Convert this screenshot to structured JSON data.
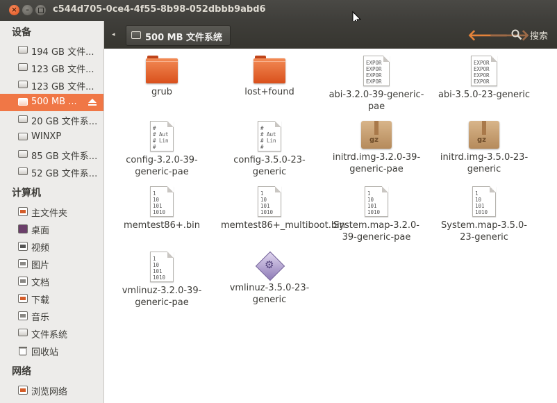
{
  "window": {
    "title": "c544d705-0ce4-4f55-8b98-052dbbb9abd6"
  },
  "sidebar": {
    "devices": {
      "heading": "设备",
      "items": [
        {
          "label": "194 GB 文件...",
          "selected": false
        },
        {
          "label": "123 GB 文件...",
          "selected": false
        },
        {
          "label": "123 GB 文件...",
          "selected": false
        },
        {
          "label": "500 MB ...",
          "selected": true
        },
        {
          "label": "20 GB 文件系...",
          "selected": false
        },
        {
          "label": "WINXP",
          "selected": false
        },
        {
          "label": "85 GB 文件系...",
          "selected": false
        },
        {
          "label": "52 GB 文件系...",
          "selected": false
        }
      ]
    },
    "computer": {
      "heading": "计算机",
      "items": [
        {
          "label": "主文件夹",
          "icon": "home-folder-icon"
        },
        {
          "label": "桌面",
          "icon": "desktop-icon"
        },
        {
          "label": "视频",
          "icon": "videos-icon"
        },
        {
          "label": "图片",
          "icon": "pictures-icon"
        },
        {
          "label": "文档",
          "icon": "documents-icon"
        },
        {
          "label": "下载",
          "icon": "downloads-icon"
        },
        {
          "label": "音乐",
          "icon": "music-icon"
        },
        {
          "label": "文件系统",
          "icon": "filesystem-icon"
        },
        {
          "label": "回收站",
          "icon": "trash-icon"
        }
      ]
    },
    "network": {
      "heading": "网络",
      "items": [
        {
          "label": "浏览网络",
          "icon": "network-icon"
        }
      ]
    }
  },
  "toolbar": {
    "path_button": "500 MB 文件系统",
    "search_label": "搜索"
  },
  "files": [
    {
      "name": "grub",
      "type": "folder"
    },
    {
      "name": "lost+found",
      "type": "folder"
    },
    {
      "name": "abi-3.2.0-39-generic-pae",
      "type": "text",
      "preview": "EXPOR\nEXPOR\nEXPOR\nEXPOR"
    },
    {
      "name": "abi-3.5.0-23-generic",
      "type": "text",
      "preview": "EXPOR\nEXPOR\nEXPOR\nEXPOR"
    },
    {
      "name": "config-3.2.0-39-generic-pae",
      "type": "text",
      "preview": "#\n# Aut\n# Lin\n#"
    },
    {
      "name": "config-3.5.0-23-generic",
      "type": "text",
      "preview": "#\n# Aut\n# Lin\n#"
    },
    {
      "name": "initrd.img-3.2.0-39-generic-pae",
      "type": "archive",
      "badge": "gz"
    },
    {
      "name": "initrd.img-3.5.0-23-generic",
      "type": "archive",
      "badge": "gz"
    },
    {
      "name": "memtest86+.bin",
      "type": "binary",
      "preview": "1\n10\n101\n1010"
    },
    {
      "name": "memtest86+_multiboot.bin",
      "type": "binary",
      "preview": "1\n10\n101\n1010"
    },
    {
      "name": "System.map-3.2.0-39-generic-pae",
      "type": "binary",
      "preview": "1\n10\n101\n1010"
    },
    {
      "name": "System.map-3.5.0-23-generic",
      "type": "binary",
      "preview": "1\n10\n101\n1010"
    },
    {
      "name": "vmlinuz-3.2.0-39-generic-pae",
      "type": "binary",
      "preview": "1\n10\n101\n1010"
    },
    {
      "name": "vmlinuz-3.5.0-23-generic",
      "type": "executable"
    }
  ],
  "colors": {
    "accent": "#f07746",
    "folder": "#e0622a",
    "titlebar": "#3f3e3a"
  }
}
